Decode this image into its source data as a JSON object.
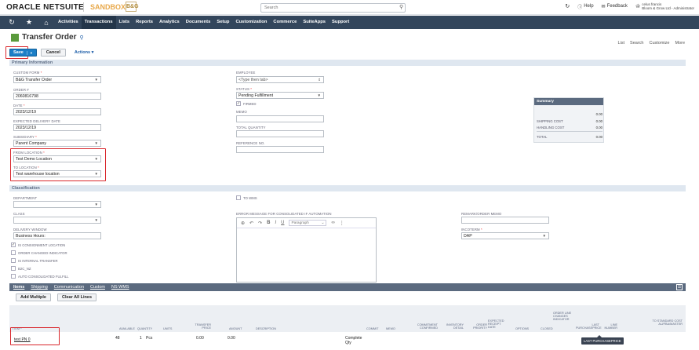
{
  "header": {
    "logo_text": "ORACLE NETSUITE",
    "sandbox_label": "SANDBOX",
    "brand_mark": "B&G",
    "search_placeholder": "Search",
    "help_label": "Help",
    "feedback_label": "Feedback",
    "user_name": "celus francis",
    "user_role": "Bloom & Grow Ltd - Administrator"
  },
  "nav": {
    "items": [
      "Activities",
      "Transactions",
      "Lists",
      "Reports",
      "Analytics",
      "Documents",
      "Setup",
      "Customization",
      "Commerce",
      "SuiteApps",
      "Support"
    ],
    "active": "Transactions"
  },
  "page": {
    "title": "Transfer Order",
    "links": [
      "List",
      "Search",
      "Customize",
      "More"
    ]
  },
  "toolbar": {
    "save_label": "Save",
    "cancel_label": "Cancel",
    "actions_label": "Actions"
  },
  "sections": {
    "primary": "Primary Information",
    "classification": "Classification"
  },
  "fields": {
    "custom_form": {
      "label": "CUSTOM FORM",
      "value": "B&G Transfer Order"
    },
    "order_no": {
      "label": "ORDER #",
      "value": "2060816798"
    },
    "date": {
      "label": "DATE",
      "value": "2023/12/19"
    },
    "expected_delivery": {
      "label": "EXPECTED DELIVERY DATE",
      "value": "2023/12/19"
    },
    "subsidiary": {
      "label": "SUBSIDIARY",
      "value": "Parent Company"
    },
    "from_location": {
      "label": "FROM LOCATION",
      "value": "Test Demo Location"
    },
    "to_location": {
      "label": "TO LOCATION",
      "value": "Test warehouse location"
    },
    "employee": {
      "label": "EMPLOYEE",
      "value": "<Type then tab>"
    },
    "status": {
      "label": "STATUS",
      "value": "Pending Fulfillment"
    },
    "firmed": {
      "label": "FIRMED"
    },
    "memo": {
      "label": "MEMO",
      "value": ""
    },
    "total_quantity": {
      "label": "TOTAL QUANTITY",
      "value": ""
    },
    "reference_no": {
      "label": "REFERENCE NO.",
      "value": ""
    },
    "department": {
      "label": "DEPARTMENT",
      "value": ""
    },
    "to_wms": {
      "label": "TO WMS"
    },
    "class": {
      "label": "CLASS",
      "value": ""
    },
    "error_message": {
      "label": "ERROR MESSAGE FOR CONSOLIDATED IF AUTOMATION"
    },
    "remark": {
      "label": "REMARK/ORDER MEMO",
      "value": ""
    },
    "delivery_window": {
      "label": "DELIVERY WINDOW",
      "value": "Business Hours:"
    },
    "incoterm": {
      "label": "INCOTERM",
      "value": "DAP"
    },
    "consignment": {
      "label": "IS CONSIGNMENT LOCATION"
    },
    "order_changed": {
      "label": "ORDER CHANGED INDICATOR"
    },
    "internal_transfer": {
      "label": "IS INTERNAL TRANSFER"
    },
    "b2c_nz": {
      "label": "B2C_NZ"
    },
    "auto_consolidated": {
      "label": "AUTO CONSOLIDATED FULFILL"
    }
  },
  "editor": {
    "paragraph_label": "Paragraph"
  },
  "summary": {
    "title": "Summary",
    "rows": [
      {
        "label": "",
        "value": "0.00"
      },
      {
        "label": "SHIPPING COST",
        "value": "0.00"
      },
      {
        "label": "HANDLING COST",
        "value": "0.00"
      },
      {
        "label": "TOTAL",
        "value": "0.00"
      }
    ]
  },
  "tabs": [
    "Items",
    "Shipping",
    "Communication",
    "Custom",
    "NS WMS"
  ],
  "item_buttons": {
    "add_multiple": "Add Multiple",
    "clear_all": "Clear All Lines"
  },
  "grid": {
    "columns": [
      "ITEM *",
      "AVAILABLE",
      "QUANTITY",
      "UNITS",
      "TRANSFER PRICE",
      "AMOUNT",
      "DESCRIPTION",
      "COMMIT",
      "MEMO",
      "COMMITMENT CONFIRMED",
      "INVENTORY DETAIL",
      "ORDER PRIORITY",
      "EXPECTED RECEIPT DATE",
      "OPTIONS",
      "CLOSED",
      "ORDER LINE CHANGES INDICATOR",
      "LAST PURCHASEPRICE",
      "LINE NUMBER",
      "TO STANDARD COST AU/FBA/MASTER"
    ],
    "row": {
      "item": "test PN 0",
      "available": "48",
      "quantity": "1",
      "units": "Pcs",
      "transfer_price": "0.00",
      "amount": "0.00",
      "commit": "Complete Qty"
    }
  },
  "tooltip": "LAST PURCHASEPRICE"
}
